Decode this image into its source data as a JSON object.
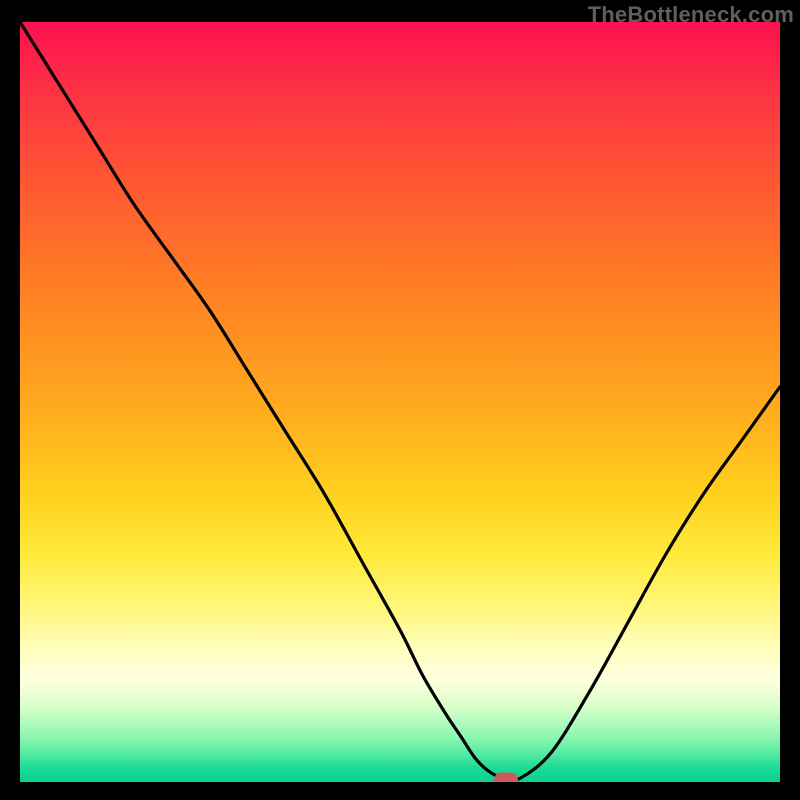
{
  "watermark": "TheBottleneck.com",
  "colors": {
    "frame": "#000000",
    "curve": "#000000",
    "marker": "#cf5a5a",
    "watermark_text": "#5f5f5f"
  },
  "chart_data": {
    "type": "line",
    "title": "",
    "xlabel": "",
    "ylabel": "",
    "xlim": [
      0,
      100
    ],
    "ylim": [
      0,
      100
    ],
    "grid": false,
    "legend": false,
    "background_gradient": {
      "orientation": "vertical",
      "stops": [
        {
          "pos": 0.0,
          "color": "#fd104f"
        },
        {
          "pos": 0.22,
          "color": "#fe5a30"
        },
        {
          "pos": 0.5,
          "color": "#ffa81e"
        },
        {
          "pos": 0.7,
          "color": "#ffe93a"
        },
        {
          "pos": 0.86,
          "color": "#ffffe0"
        },
        {
          "pos": 0.94,
          "color": "#8ef7b0"
        },
        {
          "pos": 1.0,
          "color": "#08d490"
        }
      ]
    },
    "series": [
      {
        "name": "bottleneck-curve",
        "x": [
          0,
          5,
          10,
          15,
          20,
          25,
          30,
          35,
          40,
          45,
          50,
          53,
          56,
          58,
          60,
          62,
          64,
          66,
          70,
          75,
          80,
          85,
          90,
          95,
          100
        ],
        "y": [
          100,
          92,
          84,
          76,
          69,
          62,
          54,
          46,
          38,
          29,
          20,
          14,
          9,
          6,
          3,
          1.2,
          0.4,
          0.6,
          4,
          12,
          21,
          30,
          38,
          45,
          52
        ]
      }
    ],
    "marker": {
      "x": 64,
      "y": 0.3
    }
  }
}
